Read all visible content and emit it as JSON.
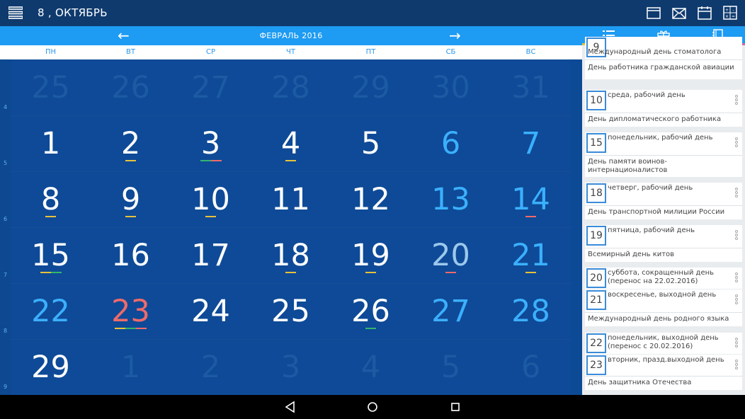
{
  "appbar": {
    "title": "8 , ОКТЯБРЬ",
    "menu_icon": "hamburger-icon",
    "actions": [
      "folder-icon",
      "envelope-icon",
      "calendar-icon",
      "calculator-icon"
    ]
  },
  "monthbar": {
    "label": "ФЕВРАЛЬ 2016",
    "prev": "←",
    "next": "→"
  },
  "weekdays": [
    "ПН",
    "ВТ",
    "СР",
    "ЧТ",
    "ПТ",
    "СБ",
    "ВС"
  ],
  "weeknums": [
    "4",
    "5",
    "6",
    "7",
    "8",
    "9"
  ],
  "weeks": [
    [
      {
        "d": "25",
        "s": "dim"
      },
      {
        "d": "26",
        "s": "dim"
      },
      {
        "d": "27",
        "s": "dim"
      },
      {
        "d": "28",
        "s": "dim"
      },
      {
        "d": "29",
        "s": "dim"
      },
      {
        "d": "30",
        "s": "dim"
      },
      {
        "d": "31",
        "s": "dim"
      }
    ],
    [
      {
        "d": "1",
        "s": ""
      },
      {
        "d": "2",
        "s": "",
        "m": [
          "#e7c239"
        ]
      },
      {
        "d": "3",
        "s": "",
        "m": [
          "#33b66d",
          "#ef6a6a"
        ]
      },
      {
        "d": "4",
        "s": "",
        "m": [
          "#e7c239"
        ]
      },
      {
        "d": "5",
        "s": ""
      },
      {
        "d": "6",
        "s": "wk"
      },
      {
        "d": "7",
        "s": "wk"
      }
    ],
    [
      {
        "d": "8",
        "s": "",
        "m": [
          "#e7c239"
        ]
      },
      {
        "d": "9",
        "s": "",
        "m": [
          "#e7c239"
        ]
      },
      {
        "d": "10",
        "s": "",
        "m": [
          "#e7c239"
        ]
      },
      {
        "d": "11",
        "s": ""
      },
      {
        "d": "12",
        "s": ""
      },
      {
        "d": "13",
        "s": "wk"
      },
      {
        "d": "14",
        "s": "wk",
        "m": [
          "#ef6a6a"
        ]
      }
    ],
    [
      {
        "d": "15",
        "s": "",
        "m": [
          "#e7c239",
          "#33b66d"
        ]
      },
      {
        "d": "16",
        "s": ""
      },
      {
        "d": "17",
        "s": ""
      },
      {
        "d": "18",
        "s": "",
        "m": [
          "#e7c239"
        ]
      },
      {
        "d": "19",
        "s": "",
        "m": [
          "#e7c239"
        ]
      },
      {
        "d": "20",
        "s": "pale",
        "m": [
          "#ef6a6a"
        ]
      },
      {
        "d": "21",
        "s": "wk",
        "m": [
          "#e7c239"
        ]
      }
    ],
    [
      {
        "d": "22",
        "s": "wk"
      },
      {
        "d": "23",
        "s": "hol",
        "m": [
          "#e7c239",
          "#33b66d",
          "#ef6a6a"
        ]
      },
      {
        "d": "24",
        "s": ""
      },
      {
        "d": "25",
        "s": ""
      },
      {
        "d": "26",
        "s": "",
        "m": [
          "#33b66d"
        ]
      },
      {
        "d": "27",
        "s": "wk"
      },
      {
        "d": "28",
        "s": "wk"
      }
    ],
    [
      {
        "d": "29",
        "s": ""
      },
      {
        "d": "1",
        "s": "dim"
      },
      {
        "d": "2",
        "s": "dim"
      },
      {
        "d": "3",
        "s": "dim"
      },
      {
        "d": "4",
        "s": "dim"
      },
      {
        "d": "5",
        "s": "dim"
      },
      {
        "d": "6",
        "s": "dim"
      }
    ]
  ],
  "panel": {
    "tabs": [
      {
        "icon": "list-icon",
        "color": "#e7c239"
      },
      {
        "icon": "gift-icon",
        "color": "#33b66d"
      },
      {
        "icon": "notebook-icon",
        "color": "#d36aa0"
      }
    ],
    "cards": [
      {
        "badge": "9",
        "day": "",
        "events": [
          "Международный день стоматолога",
          "День работника гражданской авиации"
        ]
      },
      {
        "badge": "10",
        "day": "среда, рабочий день",
        "events": [
          "День дипломатического работника"
        ]
      },
      {
        "badge": "15",
        "day": "понедельник, рабочий день",
        "events": [
          "День памяти воинов-интернационалистов"
        ]
      },
      {
        "badge": "18",
        "day": "четверг, рабочий день",
        "events": [
          "День транспортной милиции России"
        ]
      },
      {
        "badge": "19",
        "day": "пятница, рабочий день",
        "events": [
          "Всемирный день китов"
        ]
      },
      {
        "badge": "20",
        "day": "суббота, сокращенный день (перенос на 22.02.2016)",
        "events": []
      },
      {
        "badge": "21",
        "day": "воскресенье, выходной день",
        "events": [
          "Международный день родного языка"
        ]
      },
      {
        "badge": "22",
        "day": "понедельник, выходной день (перенос с 20.02.2016)",
        "events": []
      },
      {
        "badge": "23",
        "day": "вторник, празд.выходной день",
        "events": [
          "День защитника Отечества"
        ]
      }
    ]
  },
  "navbar": [
    "back-icon",
    "home-icon",
    "recents-icon"
  ]
}
